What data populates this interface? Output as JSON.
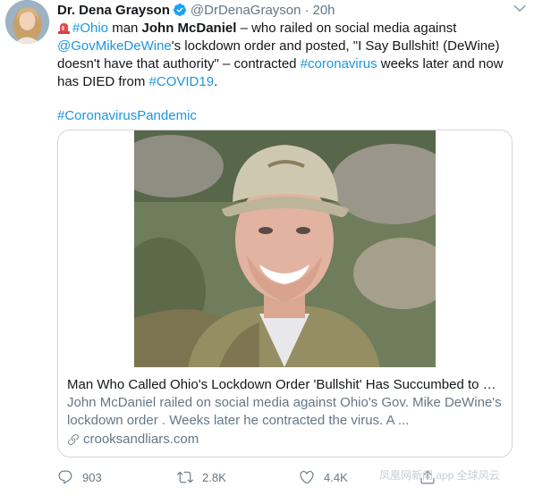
{
  "tweet": {
    "display_name": "Dr. Dena Grayson",
    "handle": "@DrDenaGrayson",
    "separator": "·",
    "time": "20h",
    "body": {
      "hashtag_ohio": "#Ohio",
      "t1": " man ",
      "name_bold": "John McDaniel",
      "t2": " – who railed on social media against ",
      "mention": "@GovMikeDeWine",
      "t3": "'s lockdown order and posted, \"I Say Bullshit! (DeWine) doesn't have that authority\" – contracted ",
      "hashtag_coronavirus": "#coronavirus",
      "t4": " weeks later and now has DIED from ",
      "hashtag_covid": "#COVID19",
      "t5": ".",
      "hashtag_pandemic": "#CoronavirusPandemic"
    },
    "card": {
      "title": "Man Who Called Ohio's Lockdown Order 'Bullshit' Has Succumbed to Coronavirus",
      "description": "John McDaniel railed on social media against Ohio's Gov. Mike DeWine's lockdown order . Weeks later he contracted the virus. A ...",
      "domain": "crooksandliars.com"
    },
    "actions": {
      "replies": "903",
      "retweets": "2.8K",
      "likes": "4.4K"
    },
    "watermark": "凤凰网新闻 app 全球风云"
  },
  "colors": {
    "link": "#1b95e0",
    "secondary": "#657786",
    "primary": "#14171a",
    "border": "#ccd6dd"
  },
  "icons": [
    "verified-icon",
    "caret-down-icon",
    "siren-icon",
    "link-icon",
    "reply-icon",
    "retweet-icon",
    "like-icon",
    "share-icon"
  ]
}
